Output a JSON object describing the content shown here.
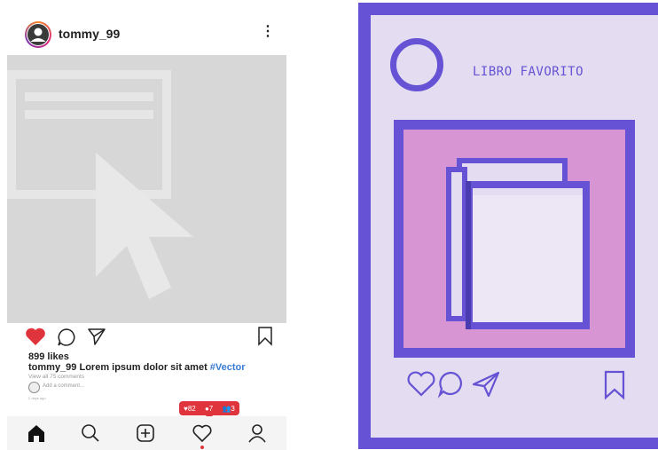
{
  "post": {
    "username": "tommy_99",
    "more_label": "⋮",
    "likes": "899 likes",
    "caption_user": "tommy_99",
    "caption_text": "Lorem ipsum dolor sit amet",
    "caption_tag": "#Vector",
    "view_comments": "View all 75 comments",
    "add_comment_placeholder": "Add a comment...",
    "time": "2 days ago"
  },
  "notification": {
    "likes": "82",
    "comments": "7",
    "followers": "3",
    "color": "#e0343d"
  },
  "icons": {
    "like": "heart-filled-icon",
    "comment": "comment-icon",
    "share": "send-icon",
    "save": "bookmark-icon",
    "nav": [
      "home-icon",
      "search-icon",
      "add-post-icon",
      "activity-heart-icon",
      "profile-icon"
    ]
  },
  "pixel_post": {
    "title": "LIBRO FAVORITO",
    "accent": "#6552d4",
    "pink": "#d796d3",
    "background": "#e4ddf1"
  }
}
